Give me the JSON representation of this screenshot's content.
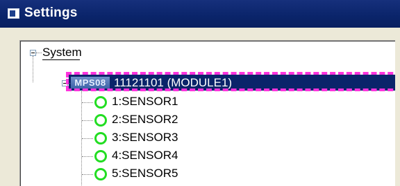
{
  "window": {
    "title": "Settings"
  },
  "tree": {
    "root": {
      "label": "System"
    },
    "module": {
      "badge": "MPS08",
      "label": "11121101 (MODULE1)"
    },
    "sensors": [
      {
        "label": "1:SENSOR1"
      },
      {
        "label": "2:SENSOR2"
      },
      {
        "label": "3:SENSOR3"
      },
      {
        "label": "4:SENSOR4"
      },
      {
        "label": "5:SENSOR5"
      }
    ]
  },
  "colors": {
    "titlebar": "#0a246a",
    "selection": "#0a246a",
    "highlight_border": "#ff33dd",
    "sensor_ok": "#22dd22"
  }
}
